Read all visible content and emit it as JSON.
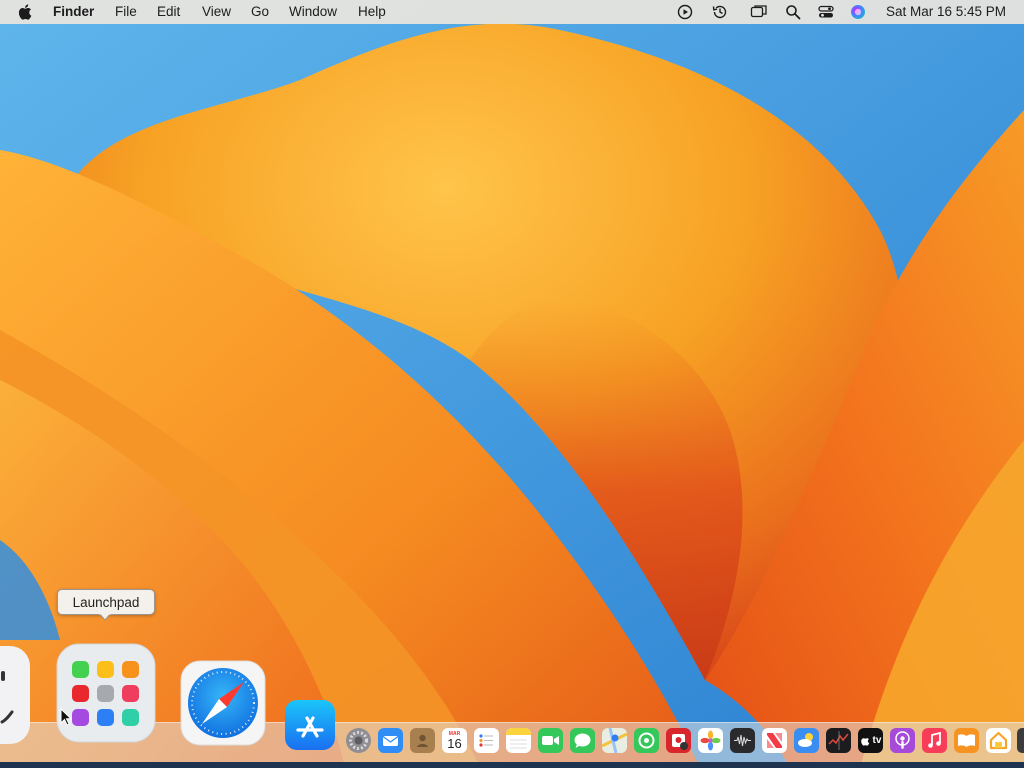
{
  "menubar": {
    "apple_icon": "apple-logo-icon",
    "app_name": "Finder",
    "menus": [
      "File",
      "Edit",
      "View",
      "Go",
      "Window",
      "Help"
    ],
    "status_icons": [
      "play-circle-icon",
      "time-machine-icon",
      "screen-mirroring-icon",
      "spotlight-search-icon",
      "control-center-icon",
      "siri-icon"
    ],
    "clock": "Sat Mar 16  5:45 PM"
  },
  "tooltip": {
    "text": "Launchpad"
  },
  "dock": {
    "large_items": [
      "Finder",
      "Launchpad",
      "Safari",
      "App Store"
    ],
    "small_items": [
      "System Settings",
      "Mail",
      "Contacts",
      "Calendar",
      "Reminders",
      "Notes",
      "FaceTime",
      "Messages",
      "Maps",
      "Find My",
      "Photo Booth",
      "Photos",
      "Voice Memos",
      "News",
      "Weather",
      "Stocks",
      "TV",
      "Podcasts",
      "Music",
      "Books",
      "Home"
    ],
    "calendar_day": "16",
    "calendar_month": "MAR",
    "tv_label": "tv"
  },
  "colors": {
    "sky": "#3f9bdc",
    "petal_orange": "#f7a224",
    "petal_deep": "#e24a17",
    "menubar_bg": "#ece6de"
  }
}
